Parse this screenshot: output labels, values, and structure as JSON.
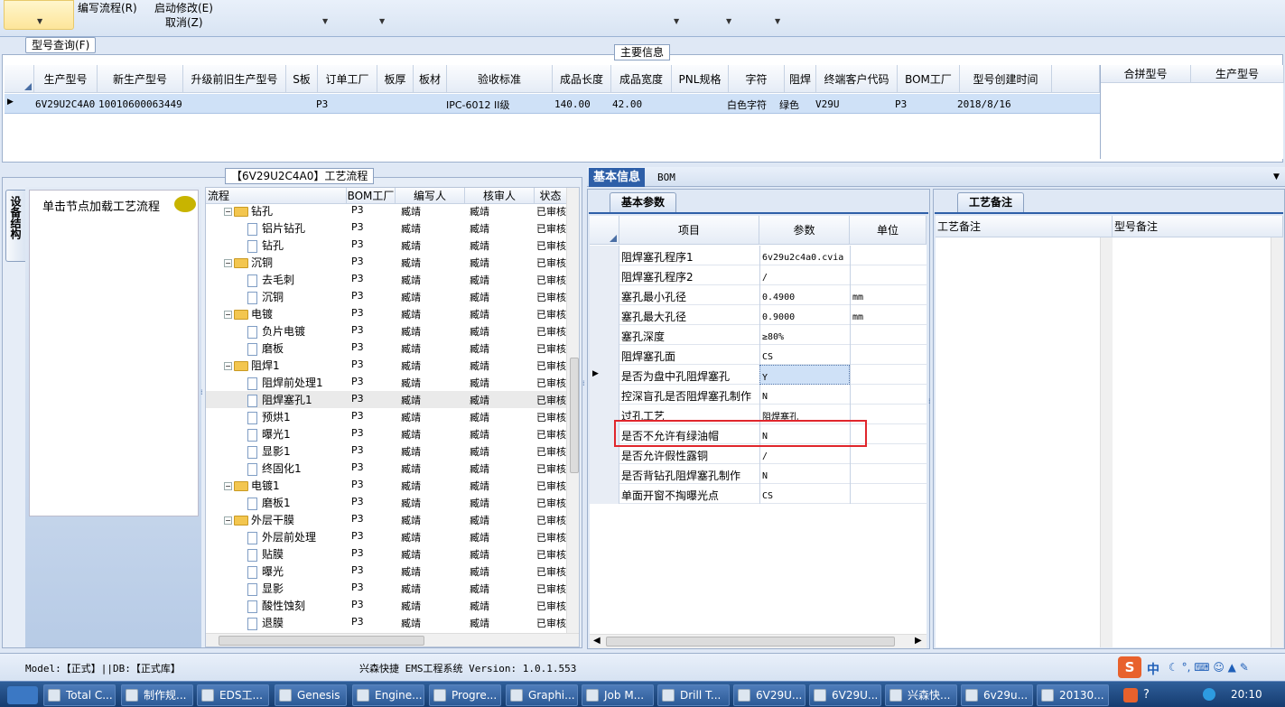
{
  "menu": {
    "edit_flow": "编写流程(R)",
    "start_modify": "启动修改(E)",
    "cancel": "取消(Z)",
    "model_query": "型号查询(F)"
  },
  "main_info": {
    "title": "主要信息",
    "columns": [
      "生产型号",
      "新生产型号",
      "升级前旧生产型号",
      "S板",
      "订单工厂",
      "板厚",
      "板材",
      "验收标准",
      "成品长度",
      "成品宽度",
      "PNL规格",
      "字符",
      "阻焊",
      "终端客户代码",
      "BOM工厂",
      "型号创建时间"
    ],
    "row": {
      "prod_model": "6V29U2C4A0",
      "new_model": "10010600063449",
      "order_factory": "P3",
      "standard": "IPC-6012 II级",
      "length": "140.00",
      "width": "42.00",
      "char": "白色字符",
      "mask": "绿色",
      "customer": "V29U",
      "bom_factory": "P3",
      "created": "2018/8/16"
    },
    "right_columns": [
      "合拼型号",
      "生产型号"
    ]
  },
  "flow": {
    "title": "【6V29U2C4A0】工艺流程",
    "side_tab": "设备结构",
    "hint": "单击节点加载工艺流程",
    "columns": [
      "流程",
      "BOM工厂",
      "编写人",
      "核审人",
      "状态"
    ],
    "rows": [
      {
        "name": "钻孔",
        "type": "folder",
        "bom": "P3",
        "writer": "臧靖",
        "reviewer": "臧靖",
        "status": "已审核"
      },
      {
        "name": "铝片钻孔",
        "type": "doc",
        "bom": "P3",
        "writer": "臧靖",
        "reviewer": "臧靖",
        "status": "已审核"
      },
      {
        "name": "钻孔",
        "type": "doc",
        "bom": "P3",
        "writer": "臧靖",
        "reviewer": "臧靖",
        "status": "已审核"
      },
      {
        "name": "沉铜",
        "type": "folder",
        "bom": "P3",
        "writer": "臧靖",
        "reviewer": "臧靖",
        "status": "已审核"
      },
      {
        "name": "去毛刺",
        "type": "doc",
        "bom": "P3",
        "writer": "臧靖",
        "reviewer": "臧靖",
        "status": "已审核"
      },
      {
        "name": "沉铜",
        "type": "doc",
        "bom": "P3",
        "writer": "臧靖",
        "reviewer": "臧靖",
        "status": "已审核"
      },
      {
        "name": "电镀",
        "type": "folder",
        "bom": "P3",
        "writer": "臧靖",
        "reviewer": "臧靖",
        "status": "已审核"
      },
      {
        "name": "负片电镀",
        "type": "doc",
        "bom": "P3",
        "writer": "臧靖",
        "reviewer": "臧靖",
        "status": "已审核"
      },
      {
        "name": "磨板",
        "type": "doc",
        "bom": "P3",
        "writer": "臧靖",
        "reviewer": "臧靖",
        "status": "已审核"
      },
      {
        "name": "阻焊1",
        "type": "folder",
        "bom": "P3",
        "writer": "臧靖",
        "reviewer": "臧靖",
        "status": "已审核"
      },
      {
        "name": "阻焊前处理1",
        "type": "doc",
        "bom": "P3",
        "writer": "臧靖",
        "reviewer": "臧靖",
        "status": "已审核"
      },
      {
        "name": "阻焊塞孔1",
        "type": "doc",
        "bom": "P3",
        "writer": "臧靖",
        "reviewer": "臧靖",
        "status": "已审核",
        "selected": true
      },
      {
        "name": "预烘1",
        "type": "doc",
        "bom": "P3",
        "writer": "臧靖",
        "reviewer": "臧靖",
        "status": "已审核"
      },
      {
        "name": "曝光1",
        "type": "doc",
        "bom": "P3",
        "writer": "臧靖",
        "reviewer": "臧靖",
        "status": "已审核"
      },
      {
        "name": "显影1",
        "type": "doc",
        "bom": "P3",
        "writer": "臧靖",
        "reviewer": "臧靖",
        "status": "已审核"
      },
      {
        "name": "终固化1",
        "type": "doc",
        "bom": "P3",
        "writer": "臧靖",
        "reviewer": "臧靖",
        "status": "已审核"
      },
      {
        "name": "电镀1",
        "type": "folder",
        "bom": "P3",
        "writer": "臧靖",
        "reviewer": "臧靖",
        "status": "已审核"
      },
      {
        "name": "磨板1",
        "type": "doc",
        "bom": "P3",
        "writer": "臧靖",
        "reviewer": "臧靖",
        "status": "已审核"
      },
      {
        "name": "外层干膜",
        "type": "folder",
        "bom": "P3",
        "writer": "臧靖",
        "reviewer": "臧靖",
        "status": "已审核"
      },
      {
        "name": "外层前处理",
        "type": "doc",
        "bom": "P3",
        "writer": "臧靖",
        "reviewer": "臧靖",
        "status": "已审核"
      },
      {
        "name": "贴膜",
        "type": "doc",
        "bom": "P3",
        "writer": "臧靖",
        "reviewer": "臧靖",
        "status": "已审核"
      },
      {
        "name": "曝光",
        "type": "doc",
        "bom": "P3",
        "writer": "臧靖",
        "reviewer": "臧靖",
        "status": "已审核"
      },
      {
        "name": "显影",
        "type": "doc",
        "bom": "P3",
        "writer": "臧靖",
        "reviewer": "臧靖",
        "status": "已审核"
      },
      {
        "name": "酸性蚀刻",
        "type": "doc",
        "bom": "P3",
        "writer": "臧靖",
        "reviewer": "臧靖",
        "status": "已审核"
      },
      {
        "name": "退膜",
        "type": "doc",
        "bom": "P3",
        "writer": "臧靖",
        "reviewer": "臧靖",
        "status": "已审核"
      }
    ]
  },
  "info_tabs": {
    "basic": "基本信息",
    "bom": "BOM"
  },
  "params": {
    "tab": "基本参数",
    "columns": [
      "项目",
      "参数",
      "单位"
    ],
    "rows": [
      {
        "name": "阻焊塞孔程序1",
        "value": "6v29u2c4a0.cvia",
        "unit": ""
      },
      {
        "name": "阻焊塞孔程序2",
        "value": "/",
        "unit": ""
      },
      {
        "name": "塞孔最小孔径",
        "value": "0.4900",
        "unit": "mm"
      },
      {
        "name": "塞孔最大孔径",
        "value": "0.9000",
        "unit": "mm"
      },
      {
        "name": "塞孔深度",
        "value": "≥80%",
        "unit": ""
      },
      {
        "name": "阻焊塞孔面",
        "value": "CS",
        "unit": ""
      },
      {
        "name": "是否为盘中孔阻焊塞孔",
        "value": "Y",
        "unit": "",
        "current": true
      },
      {
        "name": "控深盲孔是否阻焊塞孔制作",
        "value": "N",
        "unit": ""
      },
      {
        "name": "过孔工艺",
        "value": "阻焊塞孔",
        "unit": ""
      },
      {
        "name": "是否不允许有绿油帽",
        "value": "N",
        "unit": "",
        "highlight": true
      },
      {
        "name": "是否允许假性露铜",
        "value": "/",
        "unit": ""
      },
      {
        "name": "是否背钻孔阻焊塞孔制作",
        "value": "N",
        "unit": ""
      },
      {
        "name": "单面开窗不掏曝光点",
        "value": "CS",
        "unit": ""
      }
    ]
  },
  "notes": {
    "tab": "工艺备注",
    "col1": "工艺备注",
    "col2": "型号备注"
  },
  "status": {
    "model": "Model:【正式】||DB:【正式库】",
    "app": "兴森快捷 EMS工程系统 Version: 1.0.1.553"
  },
  "tray": {
    "ime": "中",
    "time": "20:10"
  },
  "taskbar": [
    "Total C...",
    "制作规...",
    "EDS工...",
    "Genesis",
    "Engine...",
    "Progre...",
    "Graphi...",
    "Job M...",
    "Drill T...",
    "6V29U...",
    "6V29U...",
    "兴森快...",
    "6v29u...",
    "20130..."
  ],
  "colors": {
    "selection": "#cfe1f7",
    "highlight_box": "#e0262c",
    "accent_tab": "#2e5fa8"
  }
}
